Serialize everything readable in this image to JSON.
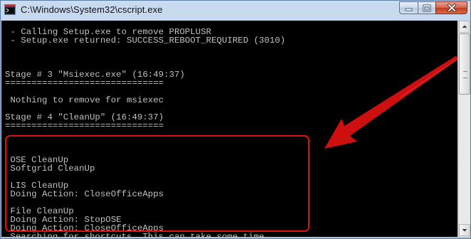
{
  "window": {
    "title": "C:\\Windows\\System32\\cscript.exe"
  },
  "colors": {
    "console_bg": "#000000",
    "console_text": "#c0c0c0",
    "highlight": "#e01010",
    "arrow": "#e01010",
    "close_button": "#c43a1c"
  },
  "icons": {
    "app": "console-app-icon",
    "minimize": "minimize-icon",
    "maximize": "maximize-icon",
    "close": "close-icon"
  },
  "console": {
    "lines": [
      " - Calling Setup.exe to remove PROPLUSR",
      " - Setup.exe returned: SUCCESS_REBOOT_REQUIRED (3010)",
      "",
      "",
      "",
      "Stage # 3 \"Msiexec.exe\" (16:49:37)",
      "==============================",
      "",
      " Nothing to remove for msiexec",
      "",
      "Stage # 4 \"CleanUp\" (16:49:37)",
      "==============================",
      "",
      "",
      "",
      " OSE CleanUp",
      " Softgrid CleanUp",
      "",
      " LIS CleanUp",
      " Doing Action: CloseOfficeApps",
      "",
      " File CleanUp",
      " Doing Action: StopOSE",
      " Doing Action: CloseOfficeApps",
      " Searching for shortcuts. This can take some time ..."
    ]
  }
}
